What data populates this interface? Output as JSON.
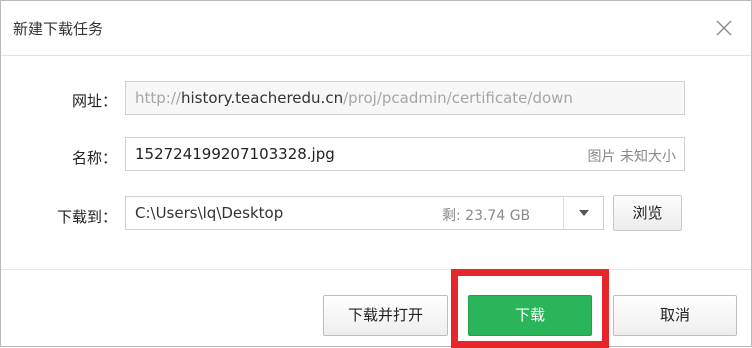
{
  "dialog": {
    "title": "新建下载任务"
  },
  "url_row": {
    "label": "网址：",
    "value_prefix": "http://",
    "value_host": "history.teacheredu.cn",
    "value_path": "/proj/pcadmin/certificate/down"
  },
  "name_row": {
    "label": "名称：",
    "value": "152724199207103328.jpg",
    "hint": "图片 未知大小"
  },
  "path_row": {
    "label": "下载到：",
    "value": "C:\\Users\\lq\\Desktop",
    "space": "剩: 23.74 GB",
    "browse_label": "浏览"
  },
  "buttons": {
    "download_open": "下载并打开",
    "download": "下载",
    "cancel": "取消"
  },
  "colors": {
    "primary": "#2bb55b",
    "highlight": "#e7262b"
  },
  "icons": {
    "close": "close-icon",
    "dropdown": "chevron-down-icon"
  }
}
